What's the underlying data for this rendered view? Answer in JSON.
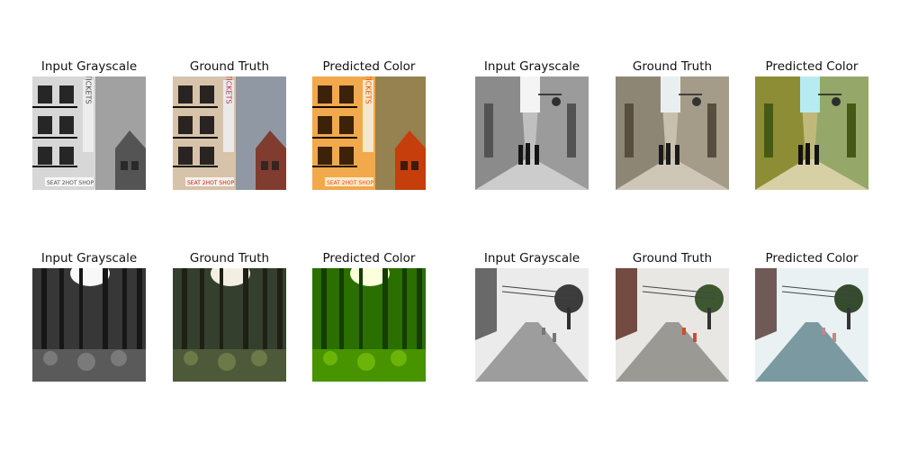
{
  "panels": [
    {
      "title": "Input Grayscale"
    },
    {
      "title": "Ground Truth"
    },
    {
      "title": "Predicted Color"
    },
    {
      "title": "Input Grayscale"
    },
    {
      "title": "Ground Truth"
    },
    {
      "title": "Predicted Color"
    },
    {
      "title": "Input Grayscale"
    },
    {
      "title": "Ground Truth"
    },
    {
      "title": "Predicted Color"
    },
    {
      "title": "Input Grayscale"
    },
    {
      "title": "Ground Truth"
    },
    {
      "title": "Predicted Color"
    }
  ],
  "scenes": {
    "building": {
      "sign_text": "TICKETS",
      "banner_text": "SEAT 2HOT SHOP"
    },
    "alley": {},
    "forest": {},
    "street": {}
  }
}
